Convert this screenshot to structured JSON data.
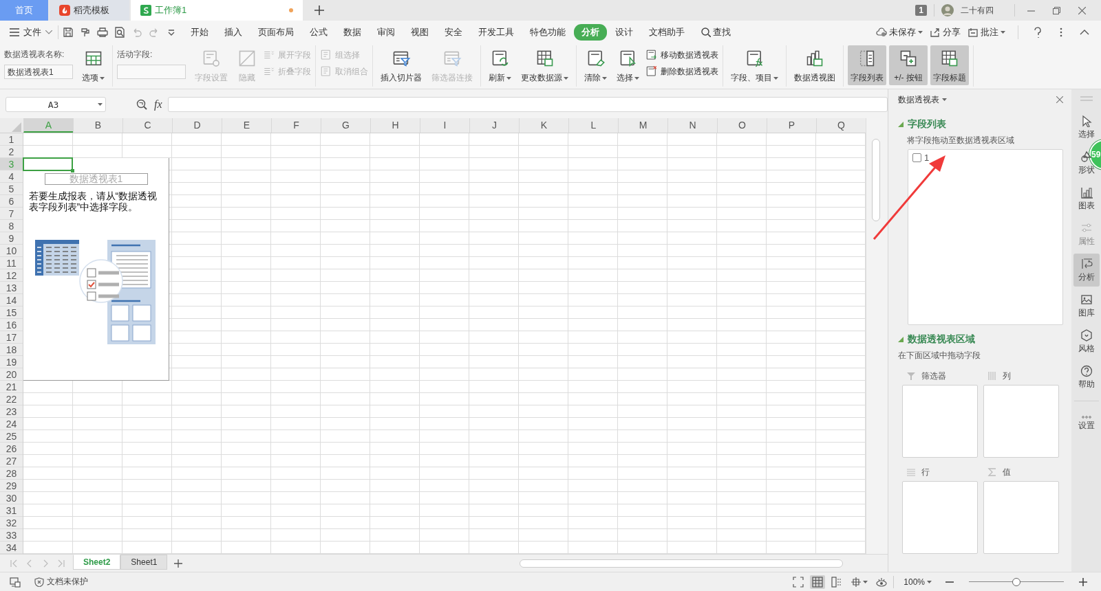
{
  "tabs": [
    {
      "label": "首页",
      "kind": "home",
      "selected": false,
      "modified": false
    },
    {
      "label": "稻壳模板",
      "kind": "docer",
      "selected": false,
      "modified": false
    },
    {
      "label": "工作簿1",
      "kind": "sheet",
      "selected": true,
      "modified": true
    }
  ],
  "account": {
    "badge": "1",
    "user": "二十有四"
  },
  "quick_access": {
    "undo_disabled": true,
    "redo_disabled": true
  },
  "menu": {
    "file": "文件",
    "items": [
      {
        "label": "开始",
        "selected": false
      },
      {
        "label": "插入",
        "selected": false
      },
      {
        "label": "页面布局",
        "selected": false
      },
      {
        "label": "公式",
        "selected": false
      },
      {
        "label": "数据",
        "selected": false
      },
      {
        "label": "审阅",
        "selected": false
      },
      {
        "label": "视图",
        "selected": false
      },
      {
        "label": "安全",
        "selected": false
      },
      {
        "label": "开发工具",
        "selected": false
      },
      {
        "label": "特色功能",
        "selected": false
      },
      {
        "label": "分析",
        "selected": true
      },
      {
        "label": "设计",
        "selected": false
      },
      {
        "label": "文档助手",
        "selected": false
      }
    ],
    "find": "查找",
    "save_state": "未保存",
    "share": "分享",
    "comment": "批注"
  },
  "ribbon": [
    {
      "items": [
        {
          "kind": "field",
          "label": "数据透视表名称:",
          "value": "数据透视表1"
        },
        {
          "kind": "big",
          "label": "选项",
          "dropdown": true,
          "disabled": false
        }
      ]
    },
    {
      "items": [
        {
          "kind": "field",
          "label": "活动字段:"
        },
        {
          "kind": "big",
          "label": "字段设置",
          "dropdown": false,
          "disabled": true
        },
        {
          "kind": "big",
          "label": "隐藏",
          "dropdown": false,
          "disabled": true
        },
        {
          "kind": "stack",
          "items": [
            {
              "label": "展开字段",
              "disabled": true
            },
            {
              "label": "折叠字段",
              "disabled": true
            }
          ]
        }
      ]
    },
    {
      "items": [
        {
          "kind": "stack",
          "items": [
            {
              "label": "组选择",
              "disabled": true
            },
            {
              "label": "取消组合",
              "disabled": true
            }
          ]
        }
      ]
    },
    {
      "items": [
        {
          "kind": "big",
          "label": "插入切片器",
          "dropdown": false,
          "disabled": false
        },
        {
          "kind": "big",
          "label": "筛选器连接",
          "dropdown": false,
          "disabled": true
        }
      ]
    },
    {
      "items": [
        {
          "kind": "big",
          "label": "刷新",
          "dropdown": true,
          "disabled": false
        },
        {
          "kind": "big",
          "label": "更改数据源",
          "dropdown": true,
          "disabled": false
        }
      ]
    },
    {
      "items": [
        {
          "kind": "big",
          "label": "清除",
          "dropdown": true,
          "disabled": false
        },
        {
          "kind": "big",
          "label": "选择",
          "dropdown": true,
          "disabled": false
        },
        {
          "kind": "stack",
          "items": [
            {
              "label": "移动数据透视表",
              "disabled": false
            },
            {
              "label": "删除数据透视表",
              "disabled": false
            }
          ]
        }
      ]
    },
    {
      "items": [
        {
          "kind": "big",
          "label": "字段、项目",
          "dropdown": true,
          "disabled": false
        }
      ]
    },
    {
      "items": [
        {
          "kind": "big",
          "label": "数据透视图",
          "dropdown": false,
          "disabled": false
        }
      ]
    },
    {
      "items": [
        {
          "kind": "toggle",
          "label": "字段列表",
          "selected": true
        },
        {
          "kind": "toggle",
          "label": "+/- 按钮",
          "selected": true
        },
        {
          "kind": "toggle",
          "label": "字段标题",
          "selected": true
        }
      ]
    }
  ],
  "name_box": "A3",
  "function_label": "fx",
  "columns": [
    {
      "label": "A",
      "selected": true
    },
    {
      "label": "B",
      "selected": false
    },
    {
      "label": "C",
      "selected": false
    },
    {
      "label": "D",
      "selected": false
    },
    {
      "label": "E",
      "selected": false
    },
    {
      "label": "F",
      "selected": false
    },
    {
      "label": "G",
      "selected": false
    },
    {
      "label": "H",
      "selected": false
    },
    {
      "label": "I",
      "selected": false
    },
    {
      "label": "J",
      "selected": false
    },
    {
      "label": "K",
      "selected": false
    },
    {
      "label": "L",
      "selected": false
    },
    {
      "label": "M",
      "selected": false
    },
    {
      "label": "N",
      "selected": false
    },
    {
      "label": "O",
      "selected": false
    },
    {
      "label": "P",
      "selected": false
    },
    {
      "label": "Q",
      "selected": false
    }
  ],
  "rows": [
    {
      "label": "1",
      "selected": false
    },
    {
      "label": "2",
      "selected": false
    },
    {
      "label": "3",
      "selected": true
    },
    {
      "label": "4",
      "selected": false
    },
    {
      "label": "5",
      "selected": false
    },
    {
      "label": "6",
      "selected": false
    },
    {
      "label": "7",
      "selected": false
    },
    {
      "label": "8",
      "selected": false
    },
    {
      "label": "9",
      "selected": false
    },
    {
      "label": "10",
      "selected": false
    },
    {
      "label": "11",
      "selected": false
    },
    {
      "label": "12",
      "selected": false
    },
    {
      "label": "13",
      "selected": false
    },
    {
      "label": "14",
      "selected": false
    },
    {
      "label": "15",
      "selected": false
    },
    {
      "label": "16",
      "selected": false
    },
    {
      "label": "17",
      "selected": false
    },
    {
      "label": "18",
      "selected": false
    },
    {
      "label": "19",
      "selected": false
    },
    {
      "label": "20",
      "selected": false
    },
    {
      "label": "21",
      "selected": false
    },
    {
      "label": "22",
      "selected": false
    },
    {
      "label": "23",
      "selected": false
    },
    {
      "label": "24",
      "selected": false
    },
    {
      "label": "25",
      "selected": false
    },
    {
      "label": "26",
      "selected": false
    },
    {
      "label": "27",
      "selected": false
    },
    {
      "label": "28",
      "selected": false
    },
    {
      "label": "29",
      "selected": false
    },
    {
      "label": "30",
      "selected": false
    },
    {
      "label": "31",
      "selected": false
    },
    {
      "label": "32",
      "selected": false
    },
    {
      "label": "33",
      "selected": false
    },
    {
      "label": "34",
      "selected": false
    }
  ],
  "pivot_placeholder": {
    "name": "数据透视表1",
    "message": "若要生成报表，请从“数据透视表字段列表”中选择字段。"
  },
  "sheets": [
    {
      "label": "Sheet2",
      "selected": true
    },
    {
      "label": "Sheet1",
      "selected": false
    }
  ],
  "panel": {
    "title": "数据透视表",
    "field_heading": "字段列表",
    "field_hint": "将字段拖动至数据透视表区域",
    "fields": [
      {
        "label": "1",
        "checked": false
      }
    ],
    "areas_heading": "数据透视表区域",
    "areas_hint": "在下面区域中拖动字段",
    "areas": [
      {
        "kind": "filter",
        "label": "筛选器"
      },
      {
        "kind": "column",
        "label": "列"
      },
      {
        "kind": "row",
        "label": "行"
      },
      {
        "kind": "value",
        "label": "值"
      }
    ]
  },
  "sidebar": [
    {
      "label": "选择",
      "selected": false,
      "disabled": false
    },
    {
      "label": "形状",
      "selected": false,
      "disabled": false
    },
    {
      "label": "图表",
      "selected": false,
      "disabled": false
    },
    {
      "label": "属性",
      "selected": false,
      "disabled": true
    },
    {
      "label": "分析",
      "selected": true,
      "disabled": false
    },
    {
      "label": "图库",
      "selected": false,
      "disabled": false
    },
    {
      "label": "风格",
      "selected": false,
      "disabled": false
    },
    {
      "label": "帮助",
      "selected": false,
      "disabled": false
    },
    {
      "label": "设置",
      "selected": false,
      "disabled": false
    }
  ],
  "float_badge": "59",
  "status": {
    "protection": "文档未保护",
    "views": [
      {
        "selected": false
      },
      {
        "selected": true
      },
      {
        "selected": false
      },
      {
        "selected": false
      },
      {
        "selected": false
      }
    ],
    "zoom": "100%",
    "zoom_slider": {
      "level": 0.5
    }
  }
}
